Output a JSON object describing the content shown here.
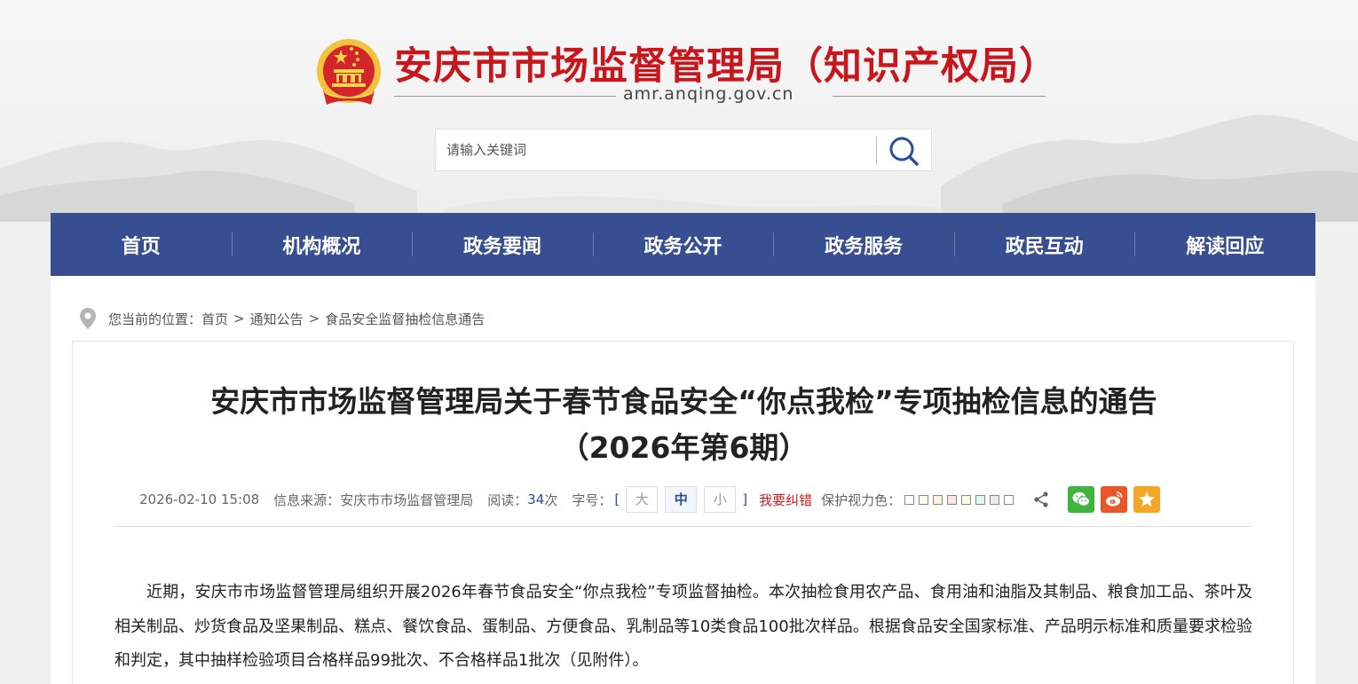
{
  "site": {
    "title": "安庆市市场监督管理局（知识产权局）",
    "domain": "amr.anqing.gov.cn"
  },
  "search": {
    "placeholder": "请输入关键词"
  },
  "nav": {
    "items": [
      "首页",
      "机构概况",
      "政务要闻",
      "政务公开",
      "政务服务",
      "政民互动",
      "解读回应"
    ]
  },
  "breadcrumb": {
    "prefix": "您当前的位置：",
    "items": [
      "首页",
      "通知公告",
      "食品安全监督抽检信息通告"
    ],
    "separator": ">"
  },
  "article": {
    "title_line1": "安庆市市场监督管理局关于春节食品安全“你点我检”专项抽检信息的通告",
    "title_line2": "（2026年第6期）",
    "meta": {
      "datetime": "2026-02-10 15:08",
      "source_label": "信息来源：",
      "source": "安庆市市场监督管理局",
      "read_label": "阅读：",
      "read_count": "34",
      "read_unit": "次",
      "fontsize_label": "字号：",
      "bracket_open": "[",
      "bracket_close": "]",
      "font_large": "大",
      "font_medium": "中",
      "font_small": "小",
      "correction": "我要纠错",
      "eye_color_label": "保护视力色："
    },
    "body": "近期，安庆市市场监督管理局组织开展2026年春节食品安全“你点我检”专项监督抽检。本次抽检食用农产品、食用油和油脂及其制品、粮食加工品、茶叶及相关制品、炒货食品及坚果制品、糕点、餐饮食品、蛋制品、方便食品、乳制品等10类食品100批次样品。根据食品安全国家标准、产品明示标准和质量要求检验和判定，其中抽样检验项目合格样品99批次、不合格样品1批次（见附件）。"
  },
  "colors": {
    "brand_red": "#c8161d",
    "nav_blue": "#374f91",
    "link_blue": "#2c4ea0",
    "wechat": "#3fb53e",
    "weibo": "#e8562a",
    "favorite": "#f5a623",
    "eye_swatches": [
      "#ffffff",
      "#fafbe6",
      "#fff2e2",
      "#fde6e0",
      "#f3ffe1",
      "#dafaf5",
      "#eaeaef",
      "#ffffff"
    ]
  },
  "icons": [
    "national-emblem-icon",
    "search-icon",
    "location-pin-icon",
    "share-icon",
    "wechat-icon",
    "weibo-icon",
    "favorite-star-icon"
  ]
}
